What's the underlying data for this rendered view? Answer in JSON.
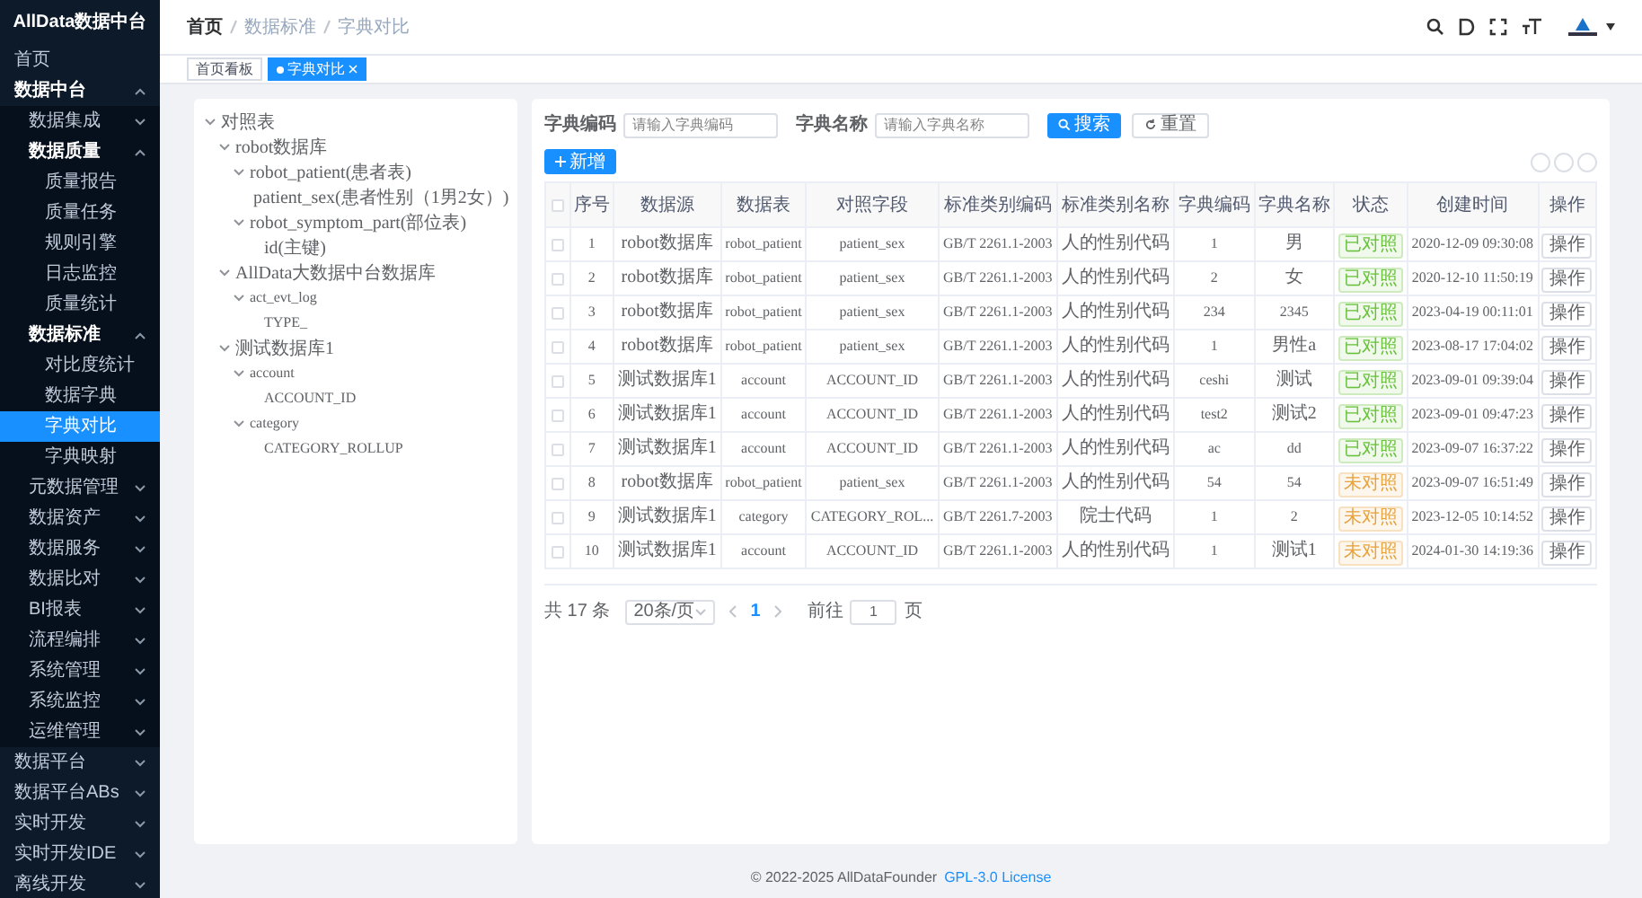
{
  "sidebar": {
    "title": "AllData数据中台",
    "items": [
      {
        "label": "首页",
        "selected": false
      },
      {
        "label": "数据中台",
        "selected": false,
        "expanded": true,
        "children": [
          {
            "label": "数据集成",
            "selected": false,
            "expanded": false
          },
          {
            "label": "数据质量",
            "selected": false,
            "expanded": true,
            "children": [
              {
                "label": "质量报告",
                "selected": false
              },
              {
                "label": "质量任务",
                "selected": false
              },
              {
                "label": "规则引擎",
                "selected": false
              },
              {
                "label": "日志监控",
                "selected": false
              },
              {
                "label": "质量统计",
                "selected": false
              }
            ]
          },
          {
            "label": "数据标准",
            "selected": false,
            "expanded": true,
            "children": [
              {
                "label": "对比度统计",
                "selected": false
              },
              {
                "label": "数据字典",
                "selected": false
              },
              {
                "label": "字典对比",
                "selected": true
              },
              {
                "label": "字典映射",
                "selected": false
              }
            ]
          },
          {
            "label": "元数据管理",
            "selected": false,
            "expanded": false
          },
          {
            "label": "数据资产",
            "selected": false,
            "expanded": false
          },
          {
            "label": "数据服务",
            "selected": false,
            "expanded": false
          },
          {
            "label": "数据比对",
            "selected": false,
            "expanded": false
          },
          {
            "label": "BI报表",
            "selected": false,
            "expanded": false
          },
          {
            "label": "流程编排",
            "selected": false,
            "expanded": false
          },
          {
            "label": "系统管理",
            "selected": false,
            "expanded": false
          },
          {
            "label": "系统监控",
            "selected": false,
            "expanded": false
          },
          {
            "label": "运维管理",
            "selected": false,
            "expanded": false
          }
        ]
      },
      {
        "label": "数据平台",
        "selected": false,
        "expanded": false
      },
      {
        "label": "数据平台ABs",
        "selected": false,
        "expanded": false
      },
      {
        "label": "实时开发",
        "selected": false,
        "expanded": false
      },
      {
        "label": "实时开发IDE",
        "selected": false,
        "expanded": false
      },
      {
        "label": "离线开发",
        "selected": false,
        "expanded": false
      }
    ]
  },
  "breadcrumb": [
    "首页",
    "数据标准",
    "字典对比"
  ],
  "tabs": [
    {
      "label": "首页看板",
      "selected": false
    },
    {
      "label": "字典对比",
      "selected": true
    }
  ],
  "tree": [
    {
      "label": "对照表",
      "expanded": true,
      "children": [
        {
          "label": "robot数据库",
          "expanded": true,
          "children": [
            {
              "label": "robot_patient(患者表)",
              "expanded": true,
              "children": [
                {
                  "label": "patient_sex(患者性别（1男2女）)"
                }
              ]
            },
            {
              "label": "robot_symptom_part(部位表)",
              "expanded": true,
              "children": [
                {
                  "label": "id(主键)"
                }
              ]
            }
          ]
        },
        {
          "label": "AllData大数据中台数据库",
          "expanded": true,
          "children": [
            {
              "label": "act_evt_log",
              "expanded": true,
              "children": [
                {
                  "label": "TYPE_"
                }
              ]
            }
          ]
        },
        {
          "label": "测试数据库1",
          "expanded": true,
          "children": [
            {
              "label": "account",
              "expanded": true,
              "children": [
                {
                  "label": "ACCOUNT_ID"
                }
              ]
            },
            {
              "label": "category",
              "expanded": true,
              "children": [
                {
                  "label": "CATEGORY_ROLLUP"
                }
              ]
            }
          ]
        }
      ]
    }
  ],
  "filters": [
    {
      "label": "字典编码",
      "placeholder": "请输入字典编码"
    },
    {
      "label": "字典名称",
      "placeholder": "请输入字典名称"
    }
  ],
  "search_button": "搜索",
  "reset_button": "重置",
  "add_button": "新增",
  "table": {
    "select_all_checked": false,
    "columns": [
      "序号",
      "数据源",
      "数据表",
      "对照字段",
      "标准类别编码",
      "标准类别名称",
      "字典编码",
      "字典名称",
      "状态",
      "创建时间",
      "操作"
    ],
    "rows": [
      {
        "checked": false,
        "cells": [
          "1",
          "robot数据库",
          "robot_patient",
          "patient_sex",
          "GB/T 2261.1-2003",
          "人的性别代码",
          "1",
          "男"
        ],
        "status": "已对照",
        "color": "#67c23a",
        "created": "2020-12-09 09:30:08",
        "action": "操作"
      },
      {
        "checked": false,
        "cells": [
          "2",
          "robot数据库",
          "robot_patient",
          "patient_sex",
          "GB/T 2261.1-2003",
          "人的性别代码",
          "2",
          "女"
        ],
        "status": "已对照",
        "color": "#67c23a",
        "created": "2020-12-10 11:50:19",
        "action": "操作"
      },
      {
        "checked": false,
        "cells": [
          "3",
          "robot数据库",
          "robot_patient",
          "patient_sex",
          "GB/T 2261.1-2003",
          "人的性别代码",
          "234",
          "2345"
        ],
        "status": "已对照",
        "color": "#67c23a",
        "created": "2023-04-19 00:11:01",
        "action": "操作"
      },
      {
        "checked": false,
        "cells": [
          "4",
          "robot数据库",
          "robot_patient",
          "patient_sex",
          "GB/T 2261.1-2003",
          "人的性别代码",
          "1",
          "男性a"
        ],
        "status": "已对照",
        "color": "#67c23a",
        "created": "2023-08-17 17:04:02",
        "action": "操作"
      },
      {
        "checked": false,
        "cells": [
          "5",
          "测试数据库1",
          "account",
          "ACCOUNT_ID",
          "GB/T 2261.1-2003",
          "人的性别代码",
          "ceshi",
          "测试"
        ],
        "status": "已对照",
        "color": "#67c23a",
        "created": "2023-09-01 09:39:04",
        "action": "操作"
      },
      {
        "checked": false,
        "cells": [
          "6",
          "测试数据库1",
          "account",
          "ACCOUNT_ID",
          "GB/T 2261.1-2003",
          "人的性别代码",
          "test2",
          "测试2"
        ],
        "status": "已对照",
        "color": "#67c23a",
        "created": "2023-09-01 09:47:23",
        "action": "操作"
      },
      {
        "checked": false,
        "cells": [
          "7",
          "测试数据库1",
          "account",
          "ACCOUNT_ID",
          "GB/T 2261.1-2003",
          "人的性别代码",
          "ac",
          "dd"
        ],
        "status": "已对照",
        "color": "#67c23a",
        "created": "2023-09-07 16:37:22",
        "action": "操作"
      },
      {
        "checked": false,
        "cells": [
          "8",
          "robot数据库",
          "robot_patient",
          "patient_sex",
          "GB/T 2261.1-2003",
          "人的性别代码",
          "54",
          "54"
        ],
        "status": "未对照",
        "color": "#e6a23c",
        "created": "2023-09-07 16:51:49",
        "action": "操作"
      },
      {
        "checked": false,
        "cells": [
          "9",
          "测试数据库1",
          "category",
          "CATEGORY_ROL...",
          "GB/T 2261.7-2003",
          "院士代码",
          "1",
          "2"
        ],
        "status": "未对照",
        "color": "#e6a23c",
        "created": "2023-12-05 10:14:52",
        "action": "操作"
      },
      {
        "checked": false,
        "cells": [
          "10",
          "测试数据库1",
          "account",
          "ACCOUNT_ID",
          "GB/T 2261.1-2003",
          "人的性别代码",
          "1",
          "测试1"
        ],
        "status": "未对照",
        "color": "#e6a23c",
        "created": "2024-01-30 14:19:36",
        "action": "操作"
      }
    ]
  },
  "pagination": {
    "total": "共 17 条",
    "page_size": "20条/页",
    "pages": [
      {
        "label": "1",
        "selected": true
      }
    ],
    "goto_label": "前往",
    "goto_value": "1",
    "goto_suffix": "页"
  },
  "footer": {
    "text": "© 2022-2025 AllDataFounder",
    "link": "GPL-3.0 License"
  }
}
